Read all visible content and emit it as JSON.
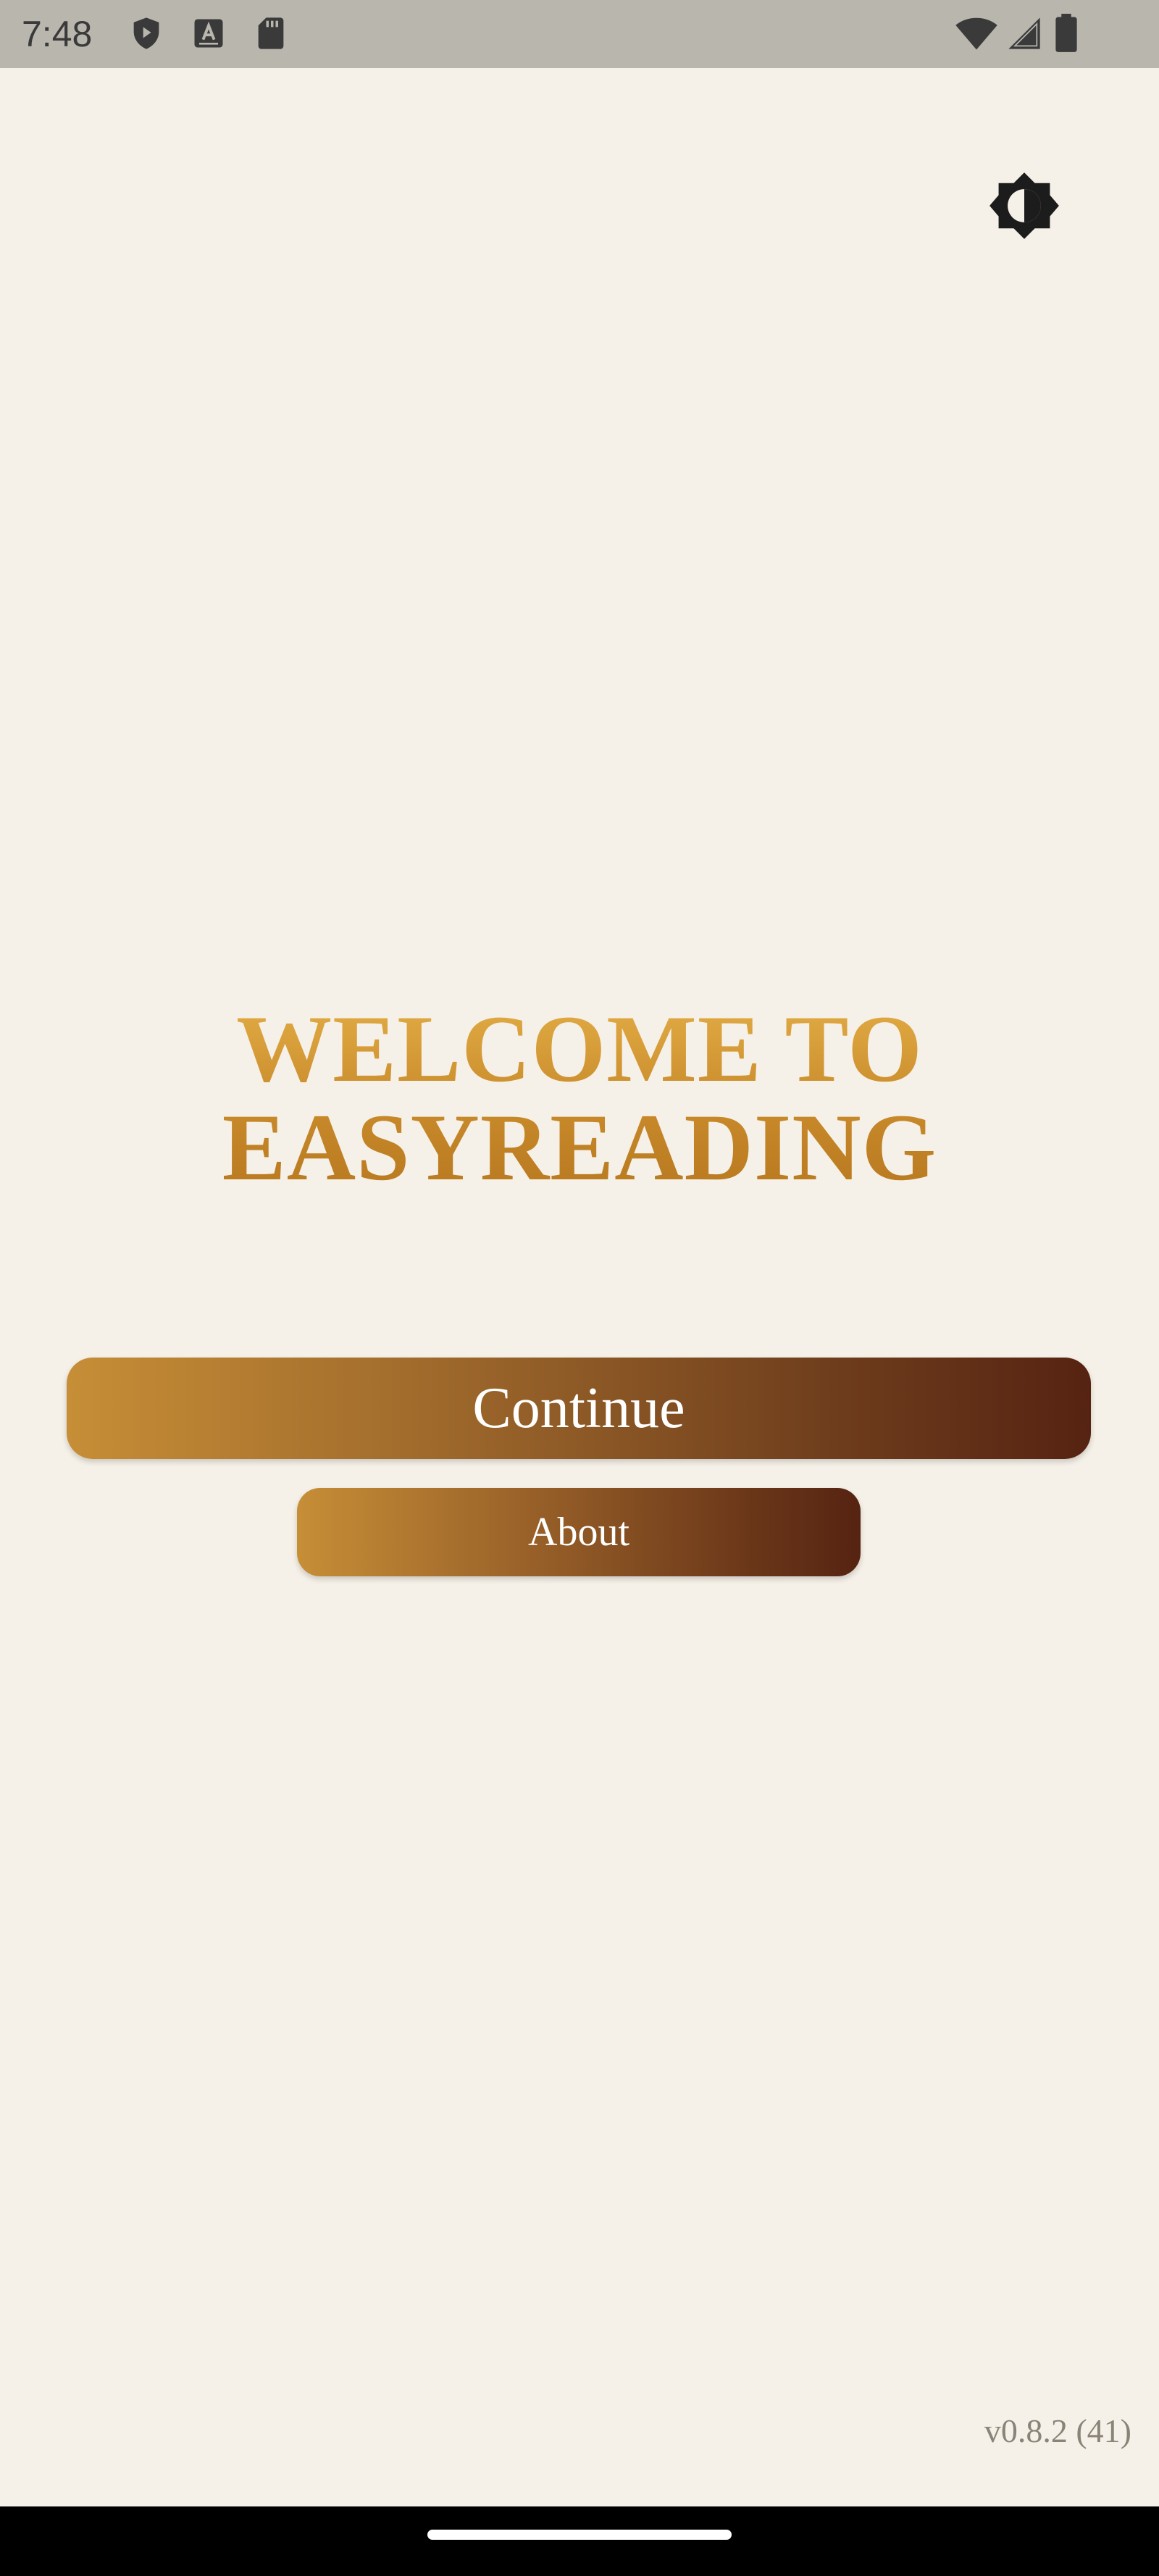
{
  "status_bar": {
    "time": "7:48",
    "left_icons": [
      "shield-play-icon",
      "keyboard-a-icon",
      "sd-card-icon"
    ],
    "right_icons": [
      "wifi-icon",
      "cell-signal-icon",
      "battery-icon"
    ]
  },
  "header": {
    "theme_toggle_icon": "brightness-contrast-icon"
  },
  "welcome": {
    "line1": "WELCOME TO",
    "line2": "EASYREADING"
  },
  "buttons": {
    "continue_label": "Continue",
    "about_label": "About"
  },
  "footer": {
    "version": "v0.8.2 (41)"
  },
  "colors": {
    "background": "#F6F1E8",
    "title_gold": "#C89030",
    "button_gradient_start": "#C68E36",
    "button_gradient_end": "#562312",
    "status_bar": "#B9B6AE"
  }
}
